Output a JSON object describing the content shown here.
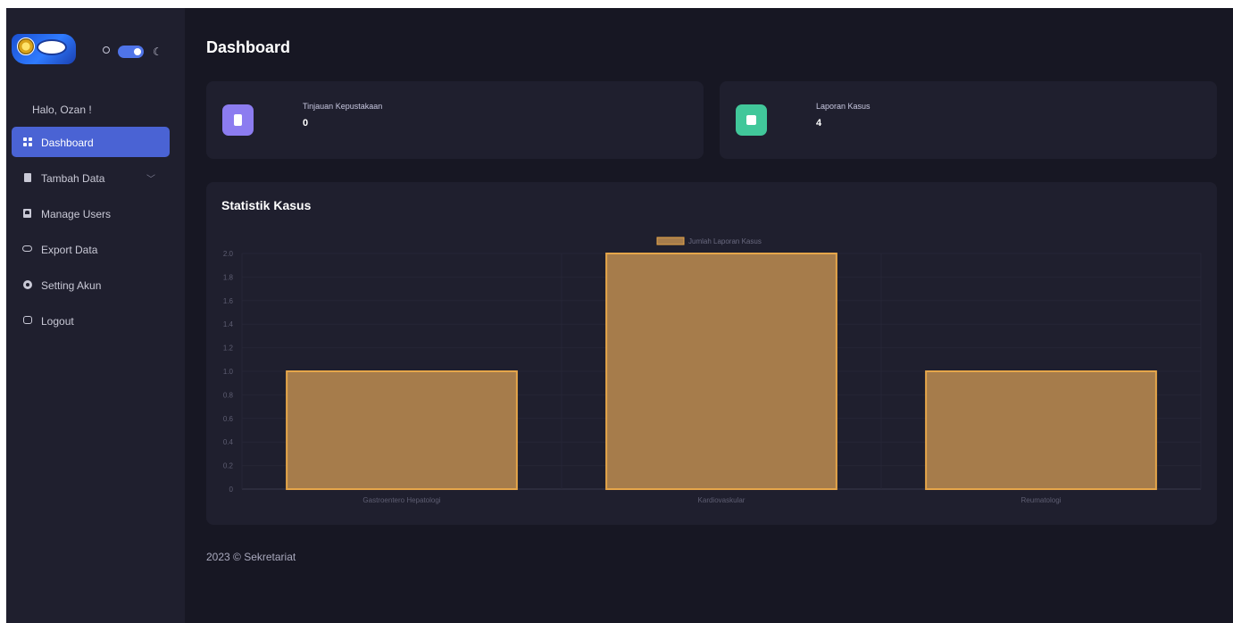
{
  "sidebar": {
    "greeting": "Halo, Ozan !",
    "items": [
      {
        "label": "Dashboard",
        "icon": "dashboard-icon"
      },
      {
        "label": "Tambah Data",
        "icon": "file-icon"
      },
      {
        "label": "Manage Users",
        "icon": "user-icon"
      },
      {
        "label": "Export Data",
        "icon": "cloud-icon"
      },
      {
        "label": "Setting Akun",
        "icon": "gear-icon"
      },
      {
        "label": "Logout",
        "icon": "logout-icon"
      }
    ]
  },
  "header": {
    "title": "Dashboard"
  },
  "stats": [
    {
      "label": "Tinjauan Kepustakaan",
      "value": "0",
      "color": "#8c7cf0"
    },
    {
      "label": "Laporan Kasus",
      "value": "4",
      "color": "#41c79a"
    }
  ],
  "chart_section": {
    "title": "Statistik Kasus"
  },
  "chart_data": {
    "type": "bar",
    "categories": [
      "Gastroentero Hepatologi",
      "Kardiovaskular",
      "Reumatologi"
    ],
    "series": [
      {
        "name": "Jumlah Laporan Kasus",
        "values": [
          1,
          2,
          1
        ],
        "color": "#a67c4b",
        "border": "#e6a64a"
      }
    ],
    "ylim": [
      0,
      2
    ],
    "yticks": [
      "0",
      "0.2",
      "0.4",
      "0.6",
      "0.8",
      "1.0",
      "1.2",
      "1.4",
      "1.6",
      "1.8",
      "2.0"
    ],
    "legend": "top-center",
    "grid": true
  },
  "footer": {
    "text": "2023 © Sekretariat"
  }
}
